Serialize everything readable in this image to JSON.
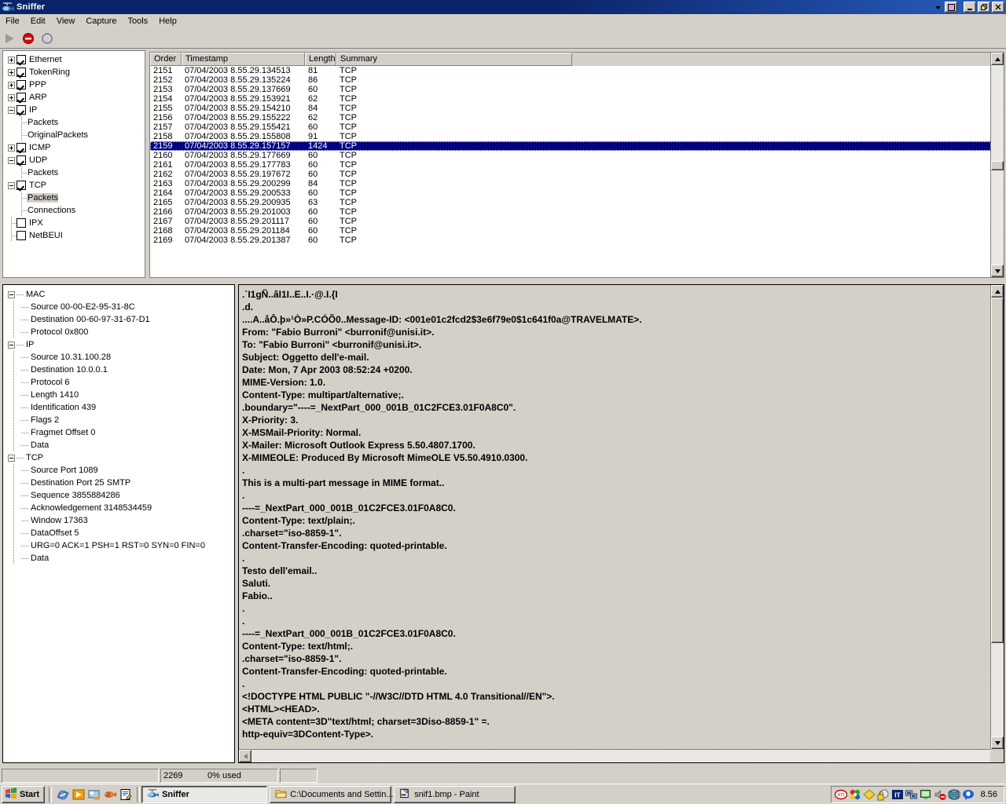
{
  "window": {
    "title": "Sniffer",
    "icon": "sniffer-fish-icon",
    "buttons": {
      "minimize": "_",
      "maximize": "❐",
      "close": "✕"
    },
    "mdi": {
      "restore_child": "■",
      "dropdown": "▾"
    }
  },
  "menu": {
    "items": [
      "File",
      "Edit",
      "View",
      "Capture",
      "Tools",
      "Help"
    ]
  },
  "toolbar": {
    "items": [
      {
        "name": "start-capture-button",
        "icon": "play-triangle-icon",
        "enabled": false
      },
      {
        "name": "stop-capture-button",
        "icon": "stop-circle-icon",
        "enabled": true
      },
      {
        "name": "pause-capture-button",
        "icon": "pause-circle-icon",
        "enabled": false
      }
    ]
  },
  "protocol_tree": {
    "nodes": [
      {
        "label": "Ethernet",
        "expander": "plus",
        "checkbox": "checked",
        "level": 0,
        "selected": false
      },
      {
        "label": "TokenRing",
        "expander": "plus",
        "checkbox": "checked",
        "level": 0,
        "selected": false
      },
      {
        "label": "PPP",
        "expander": "plus",
        "checkbox": "checked",
        "level": 0,
        "selected": false
      },
      {
        "label": "ARP",
        "expander": "plus",
        "checkbox": "checked",
        "level": 0,
        "selected": false
      },
      {
        "label": "IP",
        "expander": "minus",
        "checkbox": "checked",
        "level": 0,
        "selected": false
      },
      {
        "label": "Packets",
        "expander": "none",
        "checkbox": "none",
        "level": 1,
        "selected": false
      },
      {
        "label": "OriginalPackets",
        "expander": "none",
        "checkbox": "none",
        "level": 1,
        "selected": false
      },
      {
        "label": "ICMP",
        "expander": "plus",
        "checkbox": "checked",
        "level": 0,
        "selected": false
      },
      {
        "label": "UDP",
        "expander": "minus",
        "checkbox": "checked",
        "level": 0,
        "selected": false
      },
      {
        "label": "Packets",
        "expander": "none",
        "checkbox": "none",
        "level": 1,
        "selected": false
      },
      {
        "label": "TCP",
        "expander": "minus",
        "checkbox": "checked",
        "level": 0,
        "selected": false
      },
      {
        "label": "Packets",
        "expander": "none",
        "checkbox": "none",
        "level": 1,
        "selected": true
      },
      {
        "label": "Connections",
        "expander": "none",
        "checkbox": "none",
        "level": 1,
        "selected": false
      },
      {
        "label": "IPX",
        "expander": "none",
        "checkbox": "unchecked",
        "level": 0,
        "selected": false
      },
      {
        "label": "NetBEUI",
        "expander": "none",
        "checkbox": "unchecked",
        "level": 0,
        "selected": false
      }
    ]
  },
  "packet_list": {
    "columns": [
      "Order",
      "Timestamp",
      "Length",
      "Summary"
    ],
    "selected_order": "2159",
    "rows": [
      {
        "order": "2151",
        "timestamp": "07/04/2003 8.55.29.134513",
        "length": "81",
        "summary": "TCP"
      },
      {
        "order": "2152",
        "timestamp": "07/04/2003 8.55.29.135224",
        "length": "86",
        "summary": "TCP"
      },
      {
        "order": "2153",
        "timestamp": "07/04/2003 8.55.29.137669",
        "length": "60",
        "summary": "TCP"
      },
      {
        "order": "2154",
        "timestamp": "07/04/2003 8.55.29.153921",
        "length": "62",
        "summary": "TCP"
      },
      {
        "order": "2155",
        "timestamp": "07/04/2003 8.55.29.154210",
        "length": "84",
        "summary": "TCP"
      },
      {
        "order": "2156",
        "timestamp": "07/04/2003 8.55.29.155222",
        "length": "62",
        "summary": "TCP"
      },
      {
        "order": "2157",
        "timestamp": "07/04/2003 8.55.29.155421",
        "length": "60",
        "summary": "TCP"
      },
      {
        "order": "2158",
        "timestamp": "07/04/2003 8.55.29.155808",
        "length": "91",
        "summary": "TCP"
      },
      {
        "order": "2159",
        "timestamp": "07/04/2003 8.55.29.157157",
        "length": "1424",
        "summary": "TCP"
      },
      {
        "order": "2160",
        "timestamp": "07/04/2003 8.55.29.177669",
        "length": "60",
        "summary": "TCP"
      },
      {
        "order": "2161",
        "timestamp": "07/04/2003 8.55.29.177783",
        "length": "60",
        "summary": "TCP"
      },
      {
        "order": "2162",
        "timestamp": "07/04/2003 8.55.29.197672",
        "length": "60",
        "summary": "TCP"
      },
      {
        "order": "2163",
        "timestamp": "07/04/2003 8.55.29.200299",
        "length": "84",
        "summary": "TCP"
      },
      {
        "order": "2164",
        "timestamp": "07/04/2003 8.55.29.200533",
        "length": "60",
        "summary": "TCP"
      },
      {
        "order": "2165",
        "timestamp": "07/04/2003 8.55.29.200935",
        "length": "63",
        "summary": "TCP"
      },
      {
        "order": "2166",
        "timestamp": "07/04/2003 8.55.29.201003",
        "length": "60",
        "summary": "TCP"
      },
      {
        "order": "2167",
        "timestamp": "07/04/2003 8.55.29.201117",
        "length": "60",
        "summary": "TCP"
      },
      {
        "order": "2168",
        "timestamp": "07/04/2003 8.55.29.201184",
        "length": "60",
        "summary": "TCP"
      },
      {
        "order": "2169",
        "timestamp": "07/04/2003 8.55.29.201387",
        "length": "60",
        "summary": "TCP"
      }
    ]
  },
  "detail_tree": {
    "nodes": [
      {
        "label": "MAC",
        "expander": "minus",
        "level": 0
      },
      {
        "label": "Source 00-00-E2-95-31-8C",
        "expander": "none",
        "level": 1
      },
      {
        "label": "Destination 00-60-97-31-67-D1",
        "expander": "none",
        "level": 1
      },
      {
        "label": "Protocol 0x800",
        "expander": "none",
        "level": 1
      },
      {
        "label": "IP",
        "expander": "minus",
        "level": 0
      },
      {
        "label": "Source 10.31.100.28",
        "expander": "none",
        "level": 1
      },
      {
        "label": "Destination 10.0.0.1",
        "expander": "none",
        "level": 1
      },
      {
        "label": "Protocol 6",
        "expander": "none",
        "level": 1
      },
      {
        "label": "Length 1410",
        "expander": "none",
        "level": 1
      },
      {
        "label": "Identification 439",
        "expander": "none",
        "level": 1
      },
      {
        "label": "Flags 2",
        "expander": "none",
        "level": 1
      },
      {
        "label": "Fragmet Offset 0",
        "expander": "none",
        "level": 1
      },
      {
        "label": "Data",
        "expander": "none",
        "level": 1
      },
      {
        "label": "TCP",
        "expander": "minus",
        "level": 0
      },
      {
        "label": "Source Port 1089",
        "expander": "none",
        "level": 1
      },
      {
        "label": "Destination Port 25 SMTP",
        "expander": "none",
        "level": 1
      },
      {
        "label": "Sequence 3855884286",
        "expander": "none",
        "level": 1
      },
      {
        "label": "Acknowledgement 3148534459",
        "expander": "none",
        "level": 1
      },
      {
        "label": "Window 17363",
        "expander": "none",
        "level": 1
      },
      {
        "label": "DataOffset 5",
        "expander": "none",
        "level": 1
      },
      {
        "label": "URG=0 ACK=1 PSH=1 RST=0 SYN=0 FIN=0",
        "expander": "none",
        "level": 1
      },
      {
        "label": "Data",
        "expander": "none",
        "level": 1
      }
    ]
  },
  "content_pane": {
    "text": ".`I1gÑ..âl1I..E..I.·@.I.{I\n.d.\n....A..åÔ.þ»¹Ò»P.CÓÕ0..Message-ID: <001e01c2fcd2$3e6f79e0$1c641f0a@TRAVELMATE>.\nFrom: \"Fabio Burroni\" <burronif@unisi.it>.\nTo: \"Fabio Burroni\" <burronif@unisi.it>.\nSubject: Oggetto dell'e-mail.\nDate: Mon, 7 Apr 2003 08:52:24 +0200.\nMIME-Version: 1.0.\nContent-Type: multipart/alternative;.\n.boundary=\"----=_NextPart_000_001B_01C2FCE3.01F0A8C0\".\nX-Priority: 3.\nX-MSMail-Priority: Normal.\nX-Mailer: Microsoft Outlook Express 5.50.4807.1700.\nX-MIMEOLE: Produced By Microsoft MimeOLE V5.50.4910.0300.\n.\nThis is a multi-part message in MIME format..\n.\n----=_NextPart_000_001B_01C2FCE3.01F0A8C0.\nContent-Type: text/plain;.\n.charset=\"iso-8859-1\".\nContent-Transfer-Encoding: quoted-printable.\n.\nTesto dell'email..\nSaluti.\nFabio..\n.\n.\n----=_NextPart_000_001B_01C2FCE3.01F0A8C0.\nContent-Type: text/html;.\n.charset=\"iso-8859-1\".\nContent-Transfer-Encoding: quoted-printable.\n.\n<!DOCTYPE HTML PUBLIC \"-//W3C//DTD HTML 4.0 Transitional//EN\">.\n<HTML><HEAD>.\n<META content=3D\"text/html; charset=3Diso-8859-1\" =.\nhttp-equiv=3DContent-Type>."
  },
  "statusbar": {
    "panel1": "",
    "packet_count": "2269",
    "buffer_used": "0% used",
    "panel3": ""
  },
  "taskbar": {
    "start_label": "Start",
    "quicklaunch": [
      {
        "name": "internet-explorer-icon",
        "title": "Internet Explorer"
      },
      {
        "name": "media-player-icon",
        "title": "Windows Media Player"
      },
      {
        "name": "show-desktop-icon",
        "title": "Show Desktop"
      },
      {
        "name": "fish-icon",
        "title": "Sniffer"
      },
      {
        "name": "notepad-icon",
        "title": "Notepad"
      }
    ],
    "tasks": [
      {
        "label": "Sniffer",
        "icon": "sniffer-fish-icon",
        "active": true
      },
      {
        "label": "C:\\Documents and Settin...",
        "icon": "folder-icon",
        "active": false
      },
      {
        "label": "snif1.bmp - Paint",
        "icon": "paint-icon",
        "active": false
      }
    ],
    "tray_icons": [
      "ati-icon",
      "colorful-flower-icon",
      "yellow-diamond-icon",
      "security-lock-icon",
      "language-it-icon",
      "network-connection-icon",
      "display-icon",
      "volume-mute-icon",
      "globe-icon",
      "messenger-icon"
    ],
    "clock": "8.56"
  },
  "colors": {
    "titlebar_start": "#0a246a",
    "titlebar_end": "#2a5fbe",
    "selection": "#000080",
    "face": "#d4d0c8",
    "window": "#ffffff"
  }
}
